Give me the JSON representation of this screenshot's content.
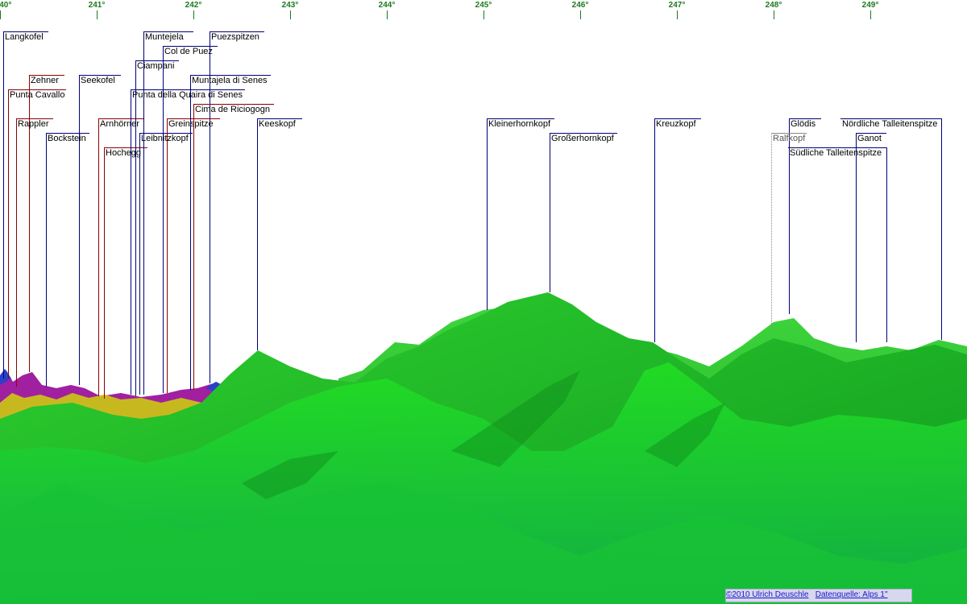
{
  "degree_labels": [
    "240°",
    "241°",
    "242°",
    "243°",
    "244°",
    "245°",
    "246°",
    "247°",
    "248°",
    "249°"
  ],
  "peaks": [
    {
      "name": "Langkofel",
      "color": "#00007a"
    },
    {
      "name": "Zehner",
      "color": "#8b0000"
    },
    {
      "name": "Punta Cavallo",
      "color": "#8b0000"
    },
    {
      "name": "Rappler",
      "color": "#8b0000"
    },
    {
      "name": "Seekofel",
      "color": "#00007a"
    },
    {
      "name": "Bockstein",
      "color": "#00007a"
    },
    {
      "name": "Arnhörner",
      "color": "#8b0000"
    },
    {
      "name": "Hochegg",
      "color": "#8b0000"
    },
    {
      "name": "Muntejela",
      "color": "#00007a"
    },
    {
      "name": "Ciampani",
      "color": "#00007a"
    },
    {
      "name": "Col de Puez",
      "color": "#00007a"
    },
    {
      "name": "Puezspitzen",
      "color": "#00007a"
    },
    {
      "name": "Punta della Quaira di Senes",
      "color": "#00007a"
    },
    {
      "name": "Leibnitzkopf",
      "color": "#00007a"
    },
    {
      "name": "Greinspitze",
      "color": "#8b0000"
    },
    {
      "name": "Muntajela di Senes",
      "color": "#00007a"
    },
    {
      "name": "Cima de Riciogogn",
      "color": "#8b0000"
    },
    {
      "name": "Keeskopf",
      "color": "#00007a"
    },
    {
      "name": "Kleinerhornkopf",
      "color": "#00007a"
    },
    {
      "name": "Großerhornkopf",
      "color": "#00007a"
    },
    {
      "name": "Kreuzkopf",
      "color": "#00007a"
    },
    {
      "name": "Glödis",
      "color": "#00007a"
    },
    {
      "name": "Ralfkopf",
      "color": "#888888"
    },
    {
      "name": "Nördliche Talleitenspitze",
      "color": "#00007a"
    },
    {
      "name": "Ganot",
      "color": "#00007a"
    },
    {
      "name": "Südliche Talleitenspitze",
      "color": "#00007a"
    }
  ],
  "credits": {
    "copyright": "©2010 Ulrich Deuschle",
    "source": "Datenquelle: Alps 1\""
  }
}
